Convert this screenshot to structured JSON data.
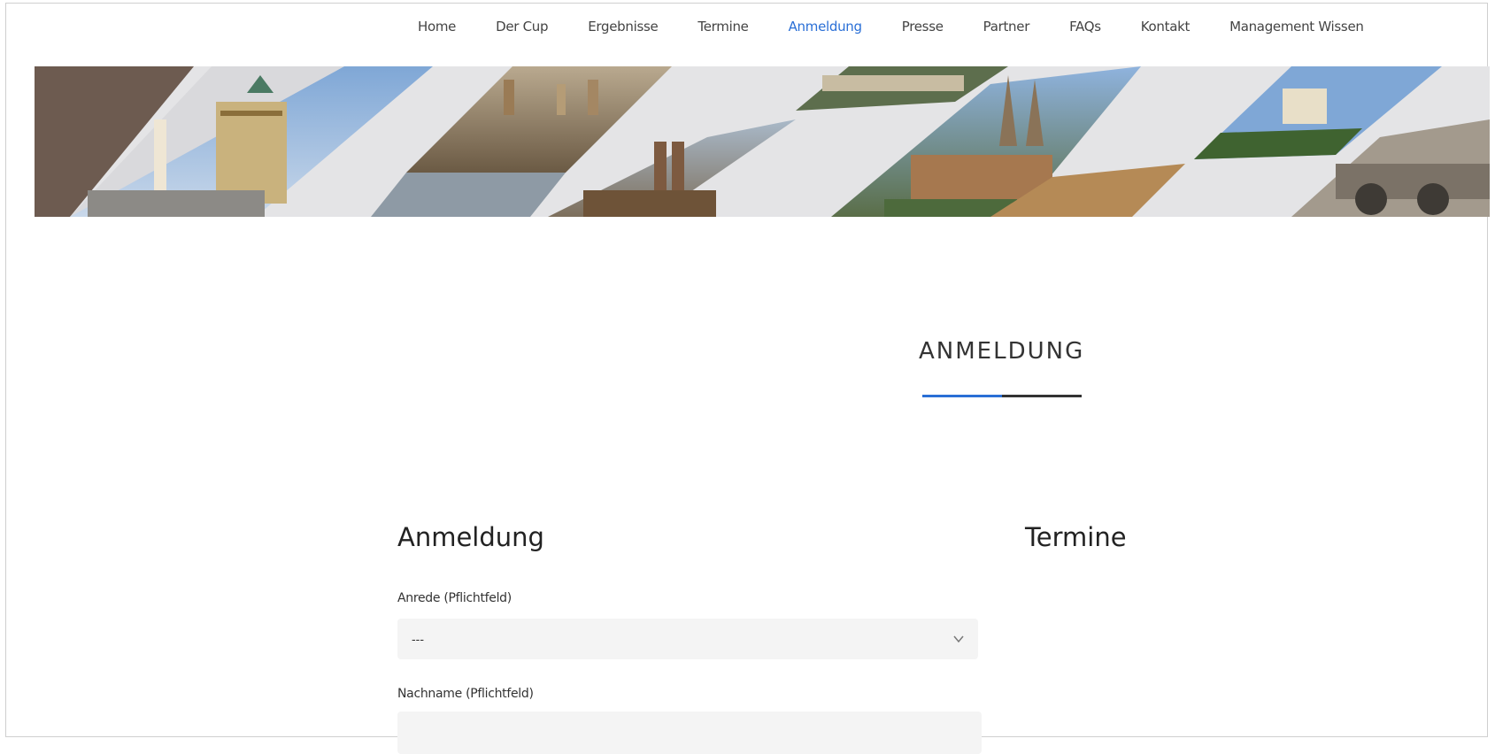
{
  "nav": {
    "items": [
      "Home",
      "Der Cup",
      "Ergebnisse",
      "Termine",
      "Anmeldung",
      "Presse",
      "Partner",
      "FAQs",
      "Kontakt",
      "Management Wissen"
    ],
    "active_index": 4,
    "active_color": "#2a6fd6"
  },
  "section": {
    "heading": "ANMELDUNG",
    "accent_color": "#2a6fd6"
  },
  "form": {
    "title": "Anmeldung",
    "anrede_label": "Anrede (Pflichtfeld)",
    "anrede_value": "---",
    "nachname_label": "Nachname (Pflichtfeld)"
  },
  "sidebar": {
    "title": "Termine"
  }
}
